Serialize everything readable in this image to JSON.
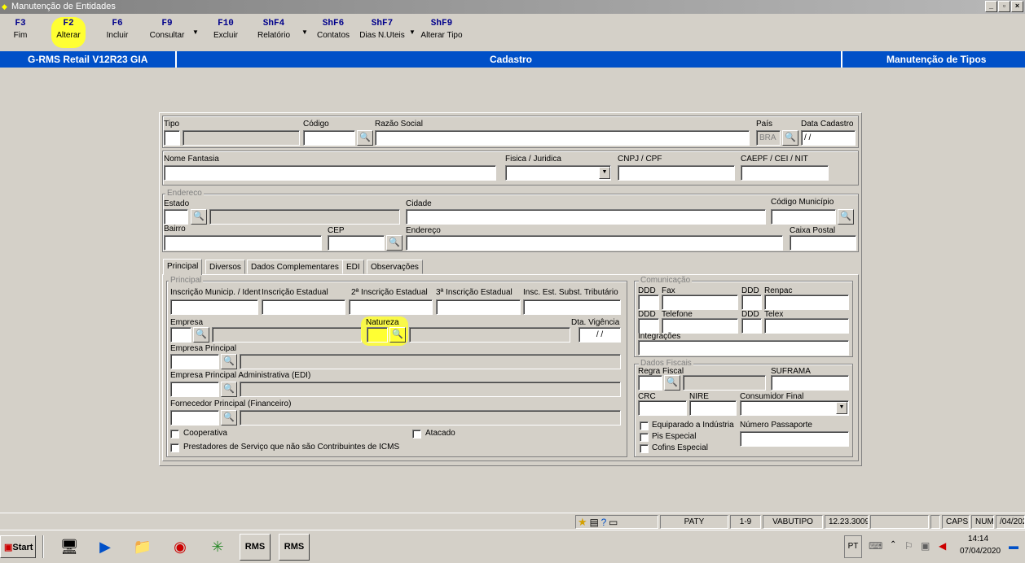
{
  "window": {
    "title": "Manutenção de Entidades"
  },
  "fkeys": [
    {
      "key": "F3",
      "label": "Fim"
    },
    {
      "key": "F2",
      "label": "Alterar"
    },
    {
      "key": "F6",
      "label": "Incluir"
    },
    {
      "key": "F9",
      "label": "Consultar"
    },
    {
      "key": "F10",
      "label": "Excluir"
    },
    {
      "key": "ShF4",
      "label": "Relatório"
    },
    {
      "key": "ShF6",
      "label": "Contatos"
    },
    {
      "key": "ShF7",
      "label": "Dias N.Uteis"
    },
    {
      "key": "ShF9",
      "label": "Alterar Tipo"
    }
  ],
  "header": {
    "system": "G-RMS Retail V12R23 GIA",
    "module": "Cadastro",
    "screen": "Manutenção de Tipos"
  },
  "form": {
    "tipo_label": "Tipo",
    "codigo_label": "Código",
    "razao_label": "Razão Social",
    "pais_label": "País",
    "pais_value": "BRA",
    "data_cadastro_label": "Data Cadastro",
    "data_cadastro_value": " / /",
    "nome_fantasia_label": "Nome Fantasia",
    "fisica_juridica_label": "Fisica / Juridica",
    "cnpj_label": "CNPJ / CPF",
    "caepf_label": "CAEPF / CEI / NIT",
    "endereco_group": "Endereco",
    "estado_label": "Estado",
    "cidade_label": "Cidade",
    "codigo_municipio_label": "Código Município",
    "bairro_label": "Bairro",
    "cep_label": "CEP",
    "endereco_label": "Endereço",
    "caixa_postal_label": "Caixa Postal"
  },
  "tabs": [
    "Principal",
    "Diversos",
    "Dados Complementares",
    "EDI",
    "Observações"
  ],
  "principal": {
    "group": "Principal",
    "insc_mun_label": "Inscrição Municip. / Ident",
    "insc_est_label": "Inscrição Estadual",
    "insc_est2_label": "2ª Inscrição Estadual",
    "insc_est3_label": "3ª Inscrição Estadual",
    "insc_subst_label": "Insc. Est. Subst. Tributário",
    "empresa_label": "Empresa",
    "natureza_label": "Natureza",
    "dta_vigencia_label": "Dta. Vigência",
    "dta_vigencia_value": " / /",
    "empresa_principal_label": "Empresa Principal",
    "empresa_principal_adm_label": "Empresa Principal Administrativa (EDI)",
    "fornecedor_principal_label": "Fornecedor Principal (Financeiro)",
    "cooperativa_label": "Cooperativa",
    "atacado_label": "Atacado",
    "prestadores_label": "Prestadores de Serviço que não são Contribuintes de ICMS"
  },
  "comunicacao": {
    "group": "Comunicação",
    "ddd_label": "DDD",
    "fax_label": "Fax",
    "renpac_label": "Renpac",
    "telefone_label": "Telefone",
    "telex_label": "Telex",
    "integracoes_label": "Integrações"
  },
  "fiscais": {
    "group": "Dados Fiscais",
    "regra_label": "Regra Fiscal",
    "suframa_label": "SUFRAMA",
    "crc_label": "CRC",
    "nire_label": "NIRE",
    "consumidor_label": "Consumidor Final",
    "equiparado_label": "Equiparado a Indústria",
    "passaporte_label": "Número Passaporte",
    "pis_label": "Pis Especial",
    "cofins_label": "Cofins Especial"
  },
  "status": {
    "user": "PATY",
    "page": "1-9",
    "table": "VABUTIPO",
    "version": "12.23.3009",
    "caps": "CAPS",
    "num": "NUM",
    "date_partial": "/04/202"
  },
  "taskbar": {
    "start": "Start",
    "rms1": "RMS",
    "rms2": "RMS",
    "lang": "PT",
    "time": "14:14",
    "date": "07/04/2020"
  },
  "colors": {
    "header_blue": "#0050c8",
    "highlight": "#ffff33",
    "key_blue": "#00008b"
  }
}
